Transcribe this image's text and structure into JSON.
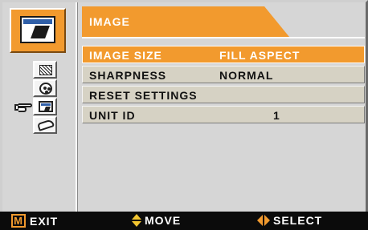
{
  "menu": {
    "title": "IMAGE",
    "rows": [
      {
        "label": "IMAGE SIZE",
        "value": "FILL ASPECT",
        "active": true
      },
      {
        "label": "SHARPNESS",
        "value": "NORMAL",
        "active": false
      },
      {
        "label": "RESET SETTINGS",
        "value": "",
        "active": false
      },
      {
        "label": "UNIT ID",
        "value": "1",
        "active": false
      }
    ]
  },
  "sidebar": {
    "main_icon": "image-settings-icon",
    "sub_icons": [
      "pattern-icon",
      "color-palette-icon",
      "image-screen-icon",
      "hand-setup-icon"
    ],
    "selected_index": 2,
    "pointer_icon": "pointing-hand-icon"
  },
  "footer": {
    "exit_key": "M",
    "exit_label": "EXIT",
    "move_label": "MOVE",
    "select_label": "SELECT"
  },
  "colors": {
    "accent": "#f29a2e",
    "row_bg": "#d6d2c4",
    "panel_bg": "#d6d6d6",
    "footer_bg": "#0b0b0b",
    "move_arrow": "#f2c530"
  }
}
